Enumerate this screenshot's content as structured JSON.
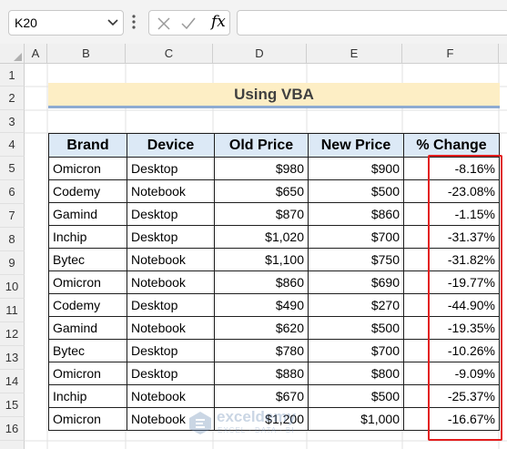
{
  "formula_bar": {
    "name_box": "K20",
    "fx_label": "fx",
    "formula": ""
  },
  "columns": [
    "A",
    "B",
    "C",
    "D",
    "E",
    "F"
  ],
  "rows": [
    "1",
    "2",
    "3",
    "4",
    "5",
    "6",
    "7",
    "8",
    "9",
    "10",
    "11",
    "12",
    "13",
    "14",
    "15",
    "16"
  ],
  "title": "Using VBA",
  "table": {
    "headers": [
      "Brand",
      "Device",
      "Old Price",
      "New Price",
      "% Change"
    ],
    "rows": [
      [
        "Omicron",
        "Desktop",
        "$980",
        "$900",
        "-8.16%"
      ],
      [
        "Codemy",
        "Notebook",
        "$650",
        "$500",
        "-23.08%"
      ],
      [
        "Gamind",
        "Desktop",
        "$870",
        "$860",
        "-1.15%"
      ],
      [
        "Inchip",
        "Desktop",
        "$1,020",
        "$700",
        "-31.37%"
      ],
      [
        "Bytec",
        "Notebook",
        "$1,100",
        "$750",
        "-31.82%"
      ],
      [
        "Omicron",
        "Notebook",
        "$860",
        "$690",
        "-19.77%"
      ],
      [
        "Codemy",
        "Desktop",
        "$490",
        "$270",
        "-44.90%"
      ],
      [
        "Gamind",
        "Notebook",
        "$620",
        "$500",
        "-19.35%"
      ],
      [
        "Bytec",
        "Desktop",
        "$780",
        "$700",
        "-10.26%"
      ],
      [
        "Omicron",
        "Desktop",
        "$880",
        "$800",
        "-9.09%"
      ],
      [
        "Inchip",
        "Notebook",
        "$670",
        "$500",
        "-25.37%"
      ],
      [
        "Omicron",
        "Notebook",
        "$1,200",
        "$1,000",
        "-16.67%"
      ]
    ]
  },
  "watermark": {
    "name": "exceldemy",
    "tagline": "EXCEL · DATA · BI"
  },
  "colors": {
    "header_fill": "#dce9f6",
    "title_fill": "#fdeec5",
    "title_underline": "#8eabd1",
    "highlight_border": "#e31d1d"
  }
}
